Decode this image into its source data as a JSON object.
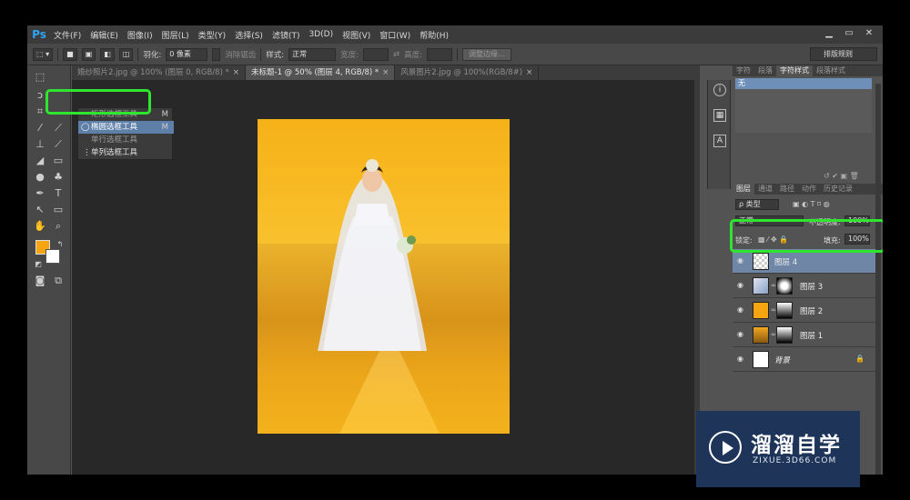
{
  "app": {
    "logo": "Ps"
  },
  "menu": [
    "文件(F)",
    "编辑(E)",
    "图像(I)",
    "图层(L)",
    "类型(Y)",
    "选择(S)",
    "滤镜(T)",
    "3D(D)",
    "视图(V)",
    "窗口(W)",
    "帮助(H)"
  ],
  "window_controls": {
    "minimize": "▁",
    "restore": "▭",
    "close": "✕"
  },
  "options": {
    "feather_label": "羽化:",
    "feather_value": "0 像素",
    "antialias_label": "消除锯齿",
    "style_label": "样式:",
    "style_value": "正常",
    "width_label": "宽度:",
    "height_label": "高度:",
    "refine_edge": "调整边缘...",
    "preset": "排版规则"
  },
  "tabs": [
    {
      "label": "婚纱照片2.jpg @ 100% (图层 0, RGB/8) *",
      "active": false
    },
    {
      "label": "未标题-1 @ 50% (图层 4, RGB/8) *",
      "active": true
    },
    {
      "label": "风景图片2.jpg @ 100%(RGB/8#)",
      "active": false
    }
  ],
  "tab_close": "×",
  "tool_flyout": {
    "items": [
      {
        "label": "矩形选框工具",
        "shortcut": "M"
      },
      {
        "label": "椭圆选框工具",
        "shortcut": "M"
      },
      {
        "label": "单行选框工具",
        "shortcut": ""
      },
      {
        "label": "单列选框工具",
        "shortcut": ""
      }
    ]
  },
  "colors": {
    "foreground": "#f5a412",
    "background": "#ffffff",
    "highlight": "#2ee62e",
    "selected_layer": "#6f86a6"
  },
  "panel_top": {
    "tabs": [
      "字符",
      "段落",
      "字符样式",
      "段落样式"
    ],
    "active_tab": "字符样式",
    "list_item": "无"
  },
  "layers_panel": {
    "tabs": [
      "图层",
      "通道",
      "路径",
      "动作",
      "历史记录"
    ],
    "filter_label": "ρ 类型",
    "blend_mode": "正常",
    "opacity_label": "不透明度:",
    "opacity_value": "100%",
    "lock_label": "锁定:",
    "fill_label": "填充:",
    "fill_value": "100%",
    "layers": [
      {
        "name": "图层 4",
        "selected": true,
        "has_mask": false
      },
      {
        "name": "图层 3",
        "selected": false,
        "has_mask": true
      },
      {
        "name": "图层 2",
        "selected": false,
        "has_mask": true
      },
      {
        "name": "图层 1",
        "selected": false,
        "has_mask": true
      },
      {
        "name": "背景",
        "selected": false,
        "has_mask": false,
        "locked": true
      }
    ]
  },
  "watermark": {
    "title": "溜溜自学",
    "subtitle": "ZIXUE.3D66.COM"
  }
}
